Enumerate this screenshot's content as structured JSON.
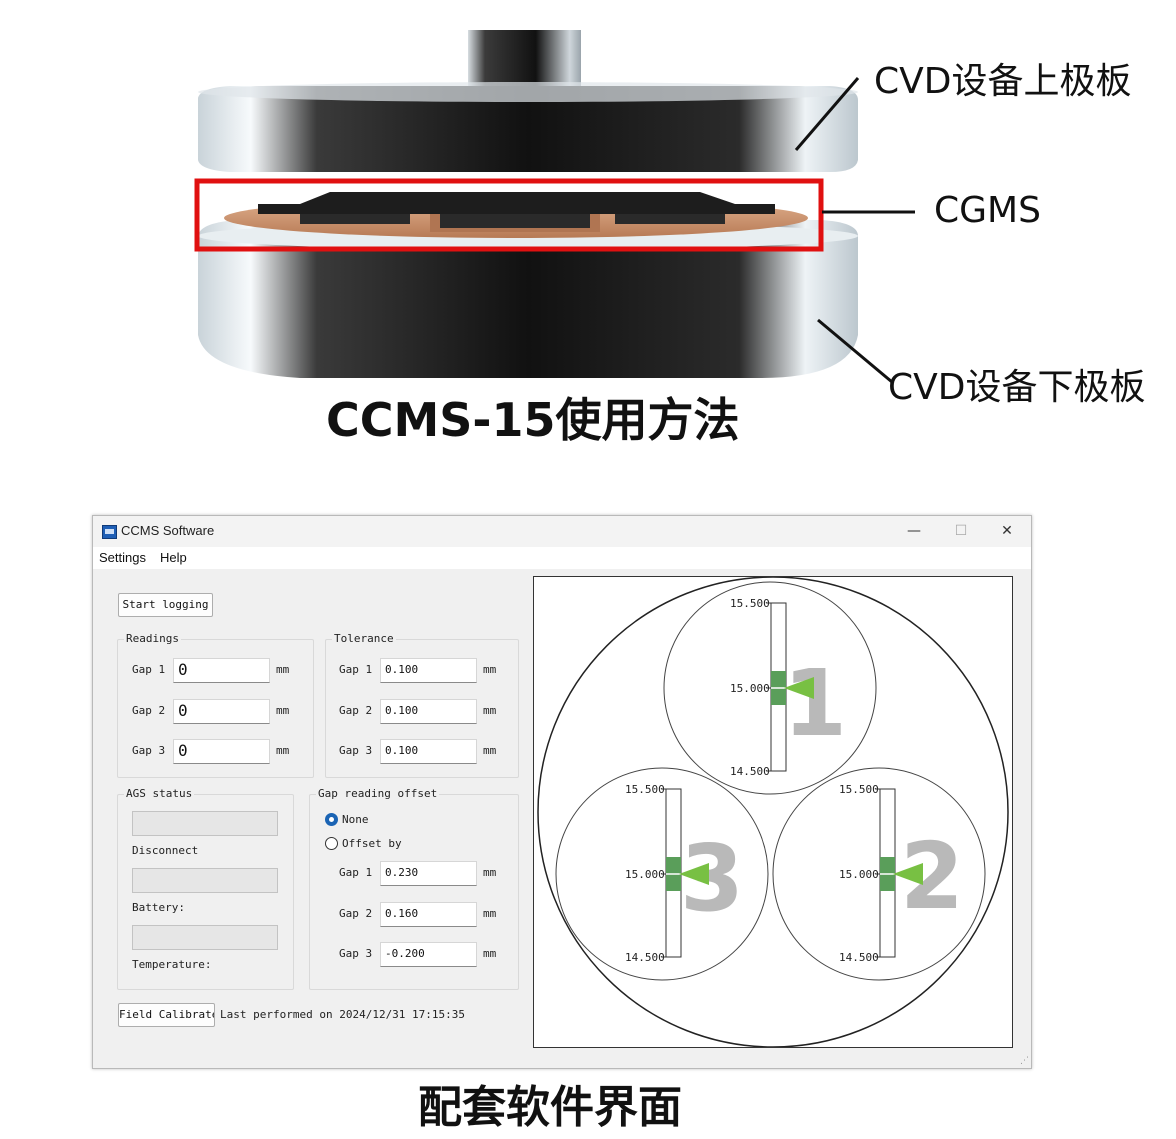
{
  "illustration": {
    "callouts": {
      "upper_plate": "CVD设备上极板",
      "cgms": "CGMS",
      "lower_plate": "CVD设备下极板"
    },
    "caption": "CCMS-15使用方法",
    "highlight_color": "#e01010"
  },
  "window": {
    "title": "CCMS Software",
    "icon": "app-icon",
    "controls": {
      "minimize": "—",
      "maximize": "☐",
      "close": "✕"
    },
    "menu": [
      "Settings",
      "Help"
    ],
    "start_logging_label": "Start logging",
    "readings": {
      "legend": "Readings",
      "rows": [
        {
          "label": "Gap 1",
          "value": "0",
          "unit": "mm"
        },
        {
          "label": "Gap 2",
          "value": "0",
          "unit": "mm"
        },
        {
          "label": "Gap 3",
          "value": "0",
          "unit": "mm"
        }
      ]
    },
    "tolerance": {
      "legend": "Tolerance",
      "rows": [
        {
          "label": "Gap 1",
          "value": "0.100",
          "unit": "mm"
        },
        {
          "label": "Gap 2",
          "value": "0.100",
          "unit": "mm"
        },
        {
          "label": "Gap 3",
          "value": "0.100",
          "unit": "mm"
        }
      ]
    },
    "ags_status": {
      "legend": "AGS status",
      "labels": [
        "Disconnect",
        "Battery:",
        "Temperature:"
      ]
    },
    "offset": {
      "legend": "Gap reading offset",
      "options": [
        "None",
        "Offset by"
      ],
      "selected": "None",
      "rows": [
        {
          "label": "Gap 1",
          "value": "0.230",
          "unit": "mm"
        },
        {
          "label": "Gap 2",
          "value": "0.160",
          "unit": "mm"
        },
        {
          "label": "Gap 3",
          "value": "-0.200",
          "unit": "mm"
        }
      ]
    },
    "calibrate": {
      "button_label": "Field Calibrate",
      "last_performed": "Last performed on 2024/12/31 17:15:35"
    },
    "gauges": [
      {
        "number": "1",
        "top": "15.500",
        "mid": "15.000",
        "bottom": "14.500"
      },
      {
        "number": "2",
        "top": "15.500",
        "mid": "15.000",
        "bottom": "14.500"
      },
      {
        "number": "3",
        "top": "15.500",
        "mid": "15.000",
        "bottom": "14.500"
      }
    ],
    "gauge_colors": {
      "band": "#5a9e5a",
      "pointer": "#78c043",
      "numeral": "#b9b9b9"
    }
  },
  "footer_caption": "配套软件界面"
}
